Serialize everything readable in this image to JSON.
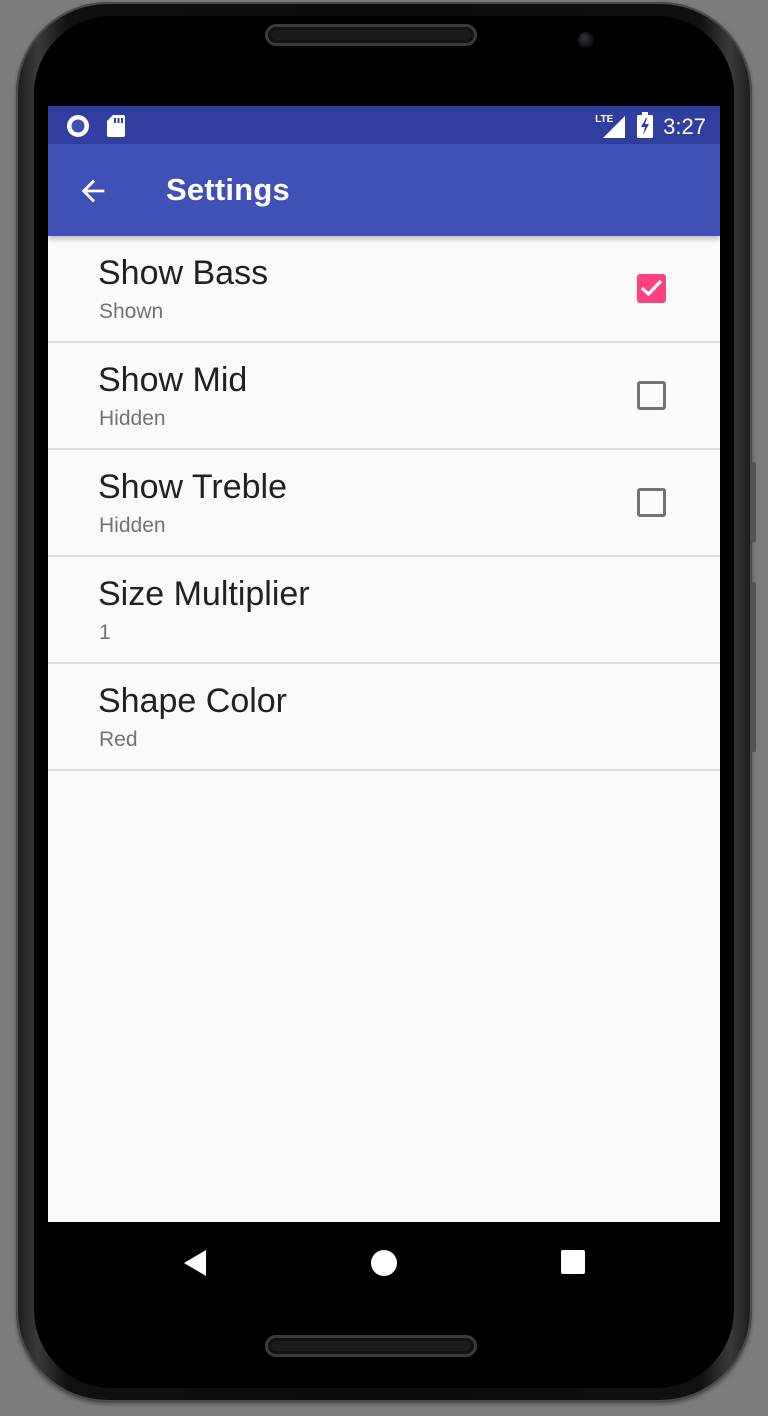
{
  "status_bar": {
    "time": "3:27",
    "icons": [
      "notification-circle-icon",
      "sd-card-icon",
      "lte-signal-icon",
      "battery-charging-icon"
    ],
    "network_label": "LTE"
  },
  "app_bar": {
    "title": "Settings",
    "back_icon": "arrow-back-icon"
  },
  "preferences": [
    {
      "title": "Show Bass",
      "summary": "Shown",
      "type": "checkbox",
      "checked": true
    },
    {
      "title": "Show Mid",
      "summary": "Hidden",
      "type": "checkbox",
      "checked": false
    },
    {
      "title": "Show Treble",
      "summary": "Hidden",
      "type": "checkbox",
      "checked": false
    },
    {
      "title": "Size Multiplier",
      "summary": "1",
      "type": "text"
    },
    {
      "title": "Shape Color",
      "summary": "Red",
      "type": "list"
    }
  ],
  "nav_bar": {
    "icons": [
      "back-triangle-icon",
      "home-circle-icon",
      "recents-square-icon"
    ]
  },
  "colors": {
    "status_bar": "#303f9f",
    "app_bar": "#3f51b5",
    "accent": "#ff4081",
    "background": "#fafafa"
  }
}
